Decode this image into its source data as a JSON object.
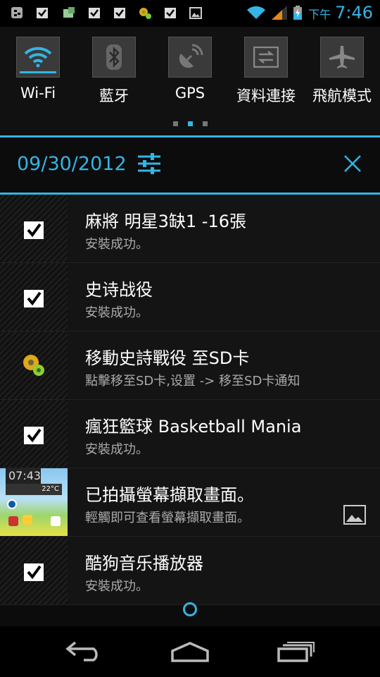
{
  "status_bar": {
    "icons": [
      "bbm-icon",
      "checkbox-icon",
      "file-manager-icon",
      "checkbox-icon",
      "checkbox-icon",
      "gear-icon",
      "checkbox-icon",
      "image-icon"
    ],
    "right_icons": [
      "wifi-icon",
      "signal-icon",
      "battery-charging-icon"
    ],
    "ampm": "下午",
    "time": "7:46",
    "accent": "#33b5e5"
  },
  "quick_settings": {
    "tiles": [
      {
        "label": "Wi-Fi",
        "icon": "wifi-icon",
        "active": true
      },
      {
        "label": "藍牙",
        "icon": "bluetooth-icon",
        "active": false
      },
      {
        "label": "GPS",
        "icon": "gps-icon",
        "active": false
      },
      {
        "label": "資料連接",
        "icon": "data-connection-icon",
        "active": false
      },
      {
        "label": "飛航模式",
        "icon": "airplane-icon",
        "active": false
      }
    ]
  },
  "header": {
    "date": "09/30/2012"
  },
  "notifications": [
    {
      "title": "麻將 明星3缺1 -16張",
      "subtitle": "安裝成功。",
      "icon": "checkbox-icon"
    },
    {
      "title": "史诗战役",
      "subtitle": "安裝成功。",
      "icon": "checkbox-icon"
    },
    {
      "title": "移動史詩戰役 至SD卡",
      "subtitle": "點擊移至SD卡,设置 -> 移至SD卡通知",
      "icon": "gear-icon"
    },
    {
      "title": "瘋狂籃球 Basketball Mania",
      "subtitle": "安裝成功。",
      "icon": "checkbox-icon"
    },
    {
      "title": "已拍攝螢幕擷取畫面。",
      "subtitle": "輕觸即可查看螢幕擷取畫面。",
      "icon": "screenshot-thumbnail",
      "thumb_time": "07:43",
      "thumb_temp": "22°C"
    },
    {
      "title": "酷狗音乐播放器",
      "subtitle": "安裝成功。",
      "icon": "checkbox-icon"
    }
  ],
  "nav": {
    "buttons": [
      "back-icon",
      "home-icon",
      "recent-apps-icon"
    ]
  }
}
